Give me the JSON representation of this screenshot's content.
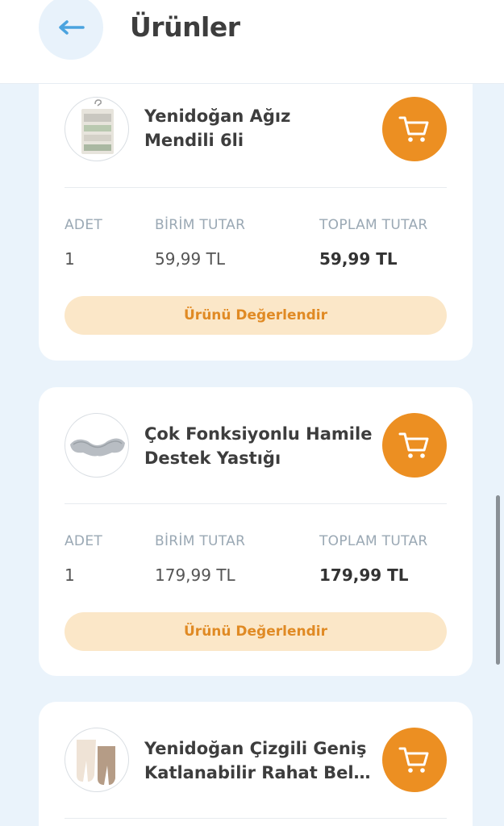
{
  "header": {
    "title": "Ürünler",
    "back_icon": "arrow-left-icon"
  },
  "labels": {
    "qty": "ADET",
    "unit_price": "BİRİM TUTAR",
    "total_price": "TOPLAM TUTAR",
    "rate_button": "Ürünü Değerlendir"
  },
  "colors": {
    "accent": "#ec8f22",
    "rate_bg": "#fbe7c8",
    "rate_text": "#e08a24",
    "back_arrow": "#4aa3df"
  },
  "products": [
    {
      "name_line1": "Yenidoğan Ağız",
      "name_line2": "Mendili 6li",
      "qty": "1",
      "unit_price": "59,99 TL",
      "total_price": "59,99 TL"
    },
    {
      "name_line1": "Çok Fonksiyonlu Hamile",
      "name_line2": "Destek Yastığı",
      "qty": "1",
      "unit_price": "179,99 TL",
      "total_price": "179,99 TL"
    },
    {
      "name_line1": "Yenidoğan Çizgili Geniş",
      "name_line2": "Katlanabilir Rahat Bel…"
    }
  ]
}
